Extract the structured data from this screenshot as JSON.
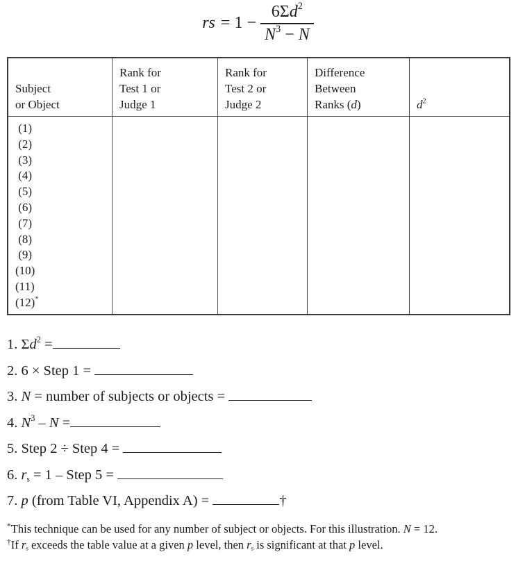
{
  "formula": {
    "lhs": "rs",
    "equals": "=",
    "one": "1",
    "minus": "−",
    "numerator": {
      "coef": "6Σ",
      "var": "d",
      "exp": "2"
    },
    "denominator": {
      "var1": "N",
      "exp": "3",
      "minus": " − ",
      "var2": "N"
    }
  },
  "table": {
    "headers": [
      {
        "lines": [
          "Subject",
          "or Object"
        ]
      },
      {
        "lines": [
          "Rank for",
          "Test 1 or",
          "Judge 1"
        ]
      },
      {
        "lines": [
          "Rank for",
          "Test 2 or",
          "Judge 2"
        ]
      },
      {
        "lines": [
          "Difference",
          "Between"
        ],
        "last_prefix": "Ranks (",
        "last_italic": "d",
        "last_suffix": ")"
      },
      {
        "var": "d",
        "exp": "2"
      }
    ],
    "rows": [
      " (1)",
      " (2)",
      " (3)",
      " (4)",
      " (5)",
      " (6)",
      " (7)",
      " (8)",
      " (9)",
      "(10)",
      "(11)",
      "(12)"
    ],
    "last_row_mark": "*",
    "cells": {
      "rank_test1": [],
      "rank_test2": [],
      "difference": [],
      "d_squared": []
    }
  },
  "steps": [
    {
      "num": "1.",
      "pre": " Σ",
      "italic": "d",
      "sup": "2",
      "post": " =",
      "value": ""
    },
    {
      "num": "2.",
      "pre": " 6 × Step 1 = ",
      "value": ""
    },
    {
      "num": "3.",
      "italic": "N",
      "post": " = number of subjects or objects = ",
      "value": ""
    },
    {
      "num": "4.",
      "italic": "N",
      "sup": "3",
      "post": " – ",
      "italic2": "N",
      "post2": " =",
      "value": ""
    },
    {
      "num": "5.",
      "pre": " Step 2 ÷ Step 4 = ",
      "value": ""
    },
    {
      "num": "6.",
      "italic": "r",
      "sub": "s",
      "post": " = 1 – Step 5 = ",
      "value": ""
    },
    {
      "num": "7.",
      "italic": "p",
      "post": " (from Table VI, Appendix A) = ",
      "value": "",
      "suffix": "†"
    }
  ],
  "footnotes": [
    {
      "mark": "*",
      "text_a": "This technique can be used for any number of subject or objects. For this illustration. ",
      "italic": "N",
      "text_b": " = 12."
    },
    {
      "mark": "†",
      "text_a": "If ",
      "italic": "r",
      "sub": "s",
      "text_b": " exceeds the table value at a given ",
      "italic2": "p",
      "text_c": " level, then ",
      "italic3": "r",
      "sub3": "s",
      "text_d": " is significant at that ",
      "italic4": "p",
      "text_e": " level."
    }
  ]
}
